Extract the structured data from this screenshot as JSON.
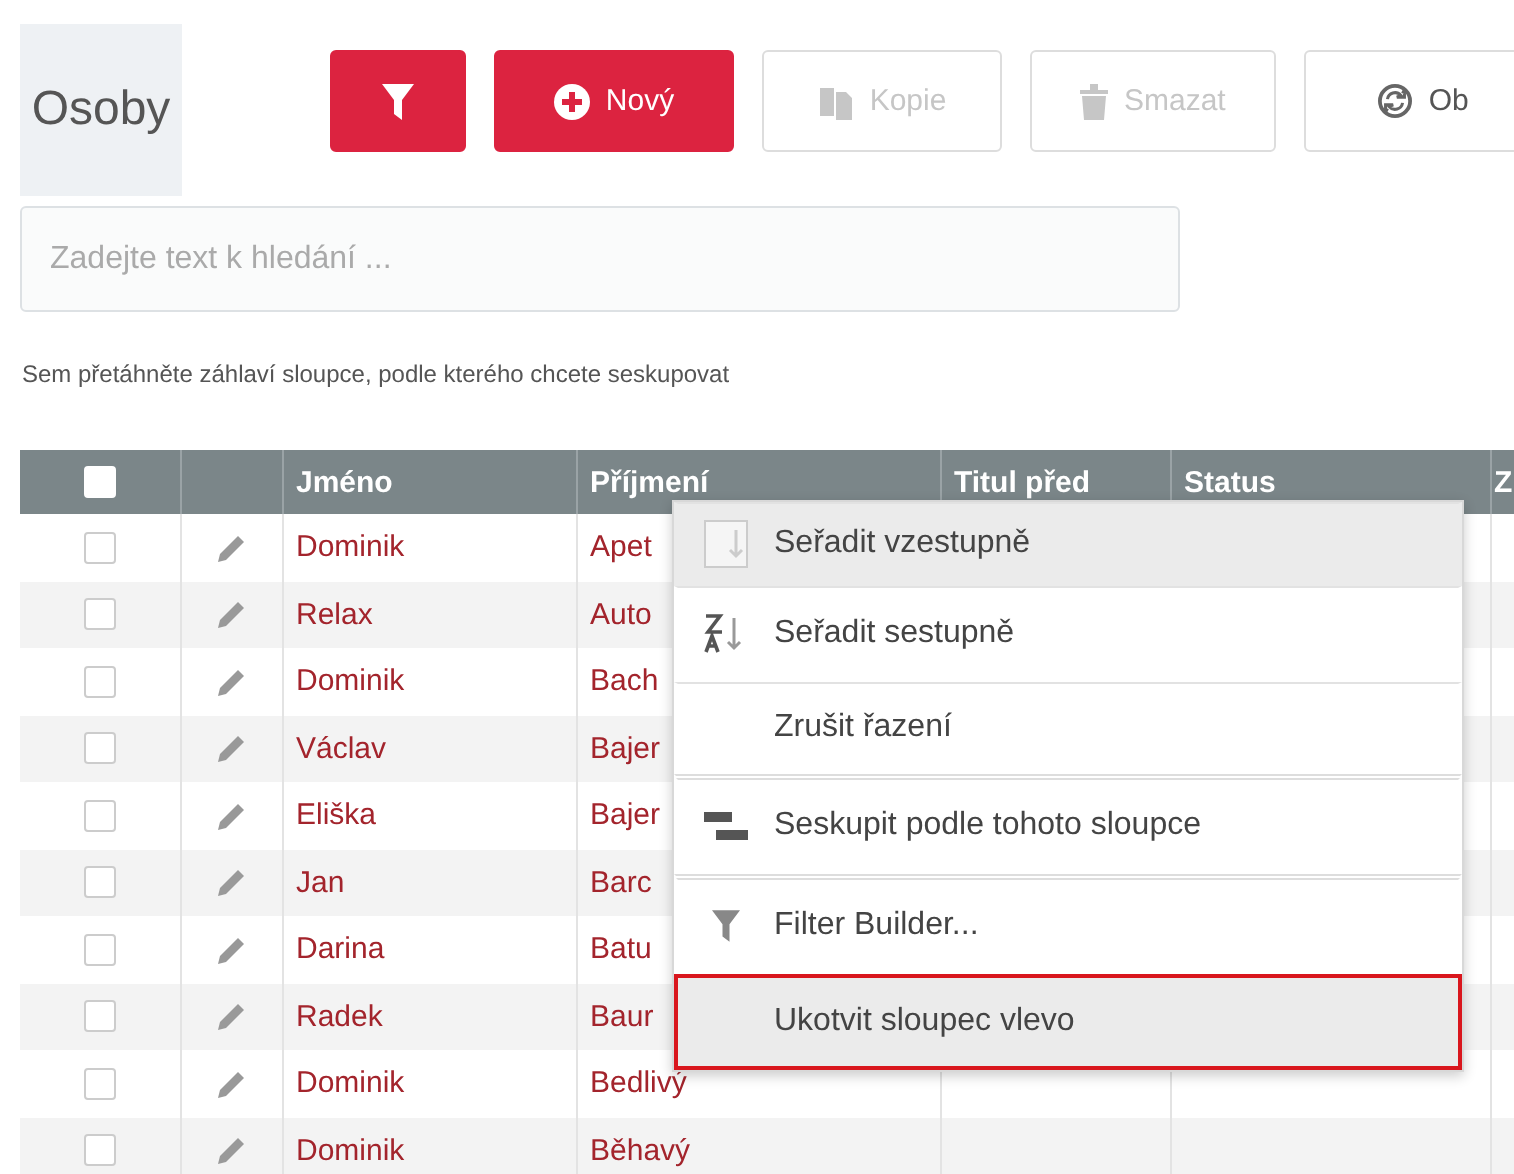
{
  "title": "Osoby",
  "toolbar": [
    {
      "kind": "filter",
      "disabled": false,
      "primary": true
    },
    {
      "kind": "add",
      "label": "Nový",
      "disabled": false,
      "primary": true
    },
    {
      "kind": "copy",
      "label": "Kopie",
      "disabled": true,
      "primary": false
    },
    {
      "kind": "delete",
      "label": "Smazat",
      "disabled": true,
      "primary": false
    },
    {
      "kind": "refresh",
      "label": "Ob",
      "disabled": false,
      "primary": false
    }
  ],
  "search": {
    "placeholder": "Zadejte text k hledání ..."
  },
  "group_hint": "Sem přetáhněte záhlaví sloupce, podle kterého chcete seskupovat",
  "table": {
    "all_checked": false,
    "columns": [
      "Jméno",
      "Příjmení",
      "Titul před",
      "Status",
      "Z"
    ],
    "rows": [
      {
        "checked": false,
        "first_name": "Dominik",
        "last_name": "Apet"
      },
      {
        "checked": false,
        "first_name": "Relax",
        "last_name": "Auto"
      },
      {
        "checked": false,
        "first_name": "Dominik",
        "last_name": "Bach"
      },
      {
        "checked": false,
        "first_name": "Václav",
        "last_name": "Bajer"
      },
      {
        "checked": false,
        "first_name": "Eliška",
        "last_name": "Bajer"
      },
      {
        "checked": false,
        "first_name": "Jan",
        "last_name": "Barc"
      },
      {
        "checked": false,
        "first_name": "Darina",
        "last_name": "Batu"
      },
      {
        "checked": false,
        "first_name": "Radek",
        "last_name": "Baur"
      },
      {
        "checked": false,
        "first_name": "Dominik",
        "last_name": "Bedlivý"
      },
      {
        "checked": false,
        "first_name": "Dominik",
        "last_name": "Běhavý"
      }
    ]
  },
  "context_menu": [
    {
      "kind": "sort-asc",
      "label": "Seřadit vzestupně",
      "highlighted": true,
      "selected": false,
      "separator_before": false
    },
    {
      "kind": "sort-desc",
      "label": "Seřadit sestupně",
      "highlighted": false,
      "selected": false,
      "separator_before": false
    },
    {
      "kind": "plain",
      "label": "Zrušit řazení",
      "highlighted": false,
      "selected": false,
      "separator_before": false
    },
    {
      "kind": "group",
      "label": "Seskupit podle tohoto sloupce",
      "highlighted": false,
      "selected": false,
      "separator_before": true
    },
    {
      "kind": "filter",
      "label": "Filter Builder...",
      "highlighted": false,
      "selected": false,
      "separator_before": true
    },
    {
      "kind": "plain",
      "label": "Ukotvit sloupec vlevo",
      "highlighted": false,
      "selected": true,
      "separator_before": false
    }
  ]
}
